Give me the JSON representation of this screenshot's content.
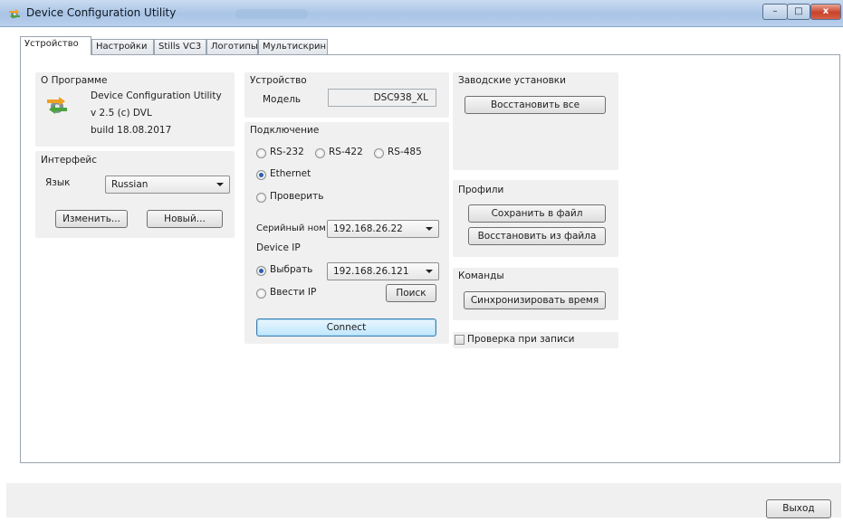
{
  "window": {
    "title": "Device Configuration Utility",
    "app_icon": "gear-arrows-icon",
    "controls": {
      "minimize": "–",
      "maximize": "□",
      "close": "x"
    }
  },
  "tabs": [
    {
      "label": "Устройство",
      "active": true
    },
    {
      "label": "Настройки",
      "active": false
    },
    {
      "label": "Stills VC3",
      "active": false
    },
    {
      "label": "Логотипы",
      "active": false
    },
    {
      "label": "Мультискрин",
      "active": false
    }
  ],
  "about": {
    "title": "О Программе",
    "product": "Device Configuration Utility",
    "version": "v 2.5  (c) DVL",
    "build": "build  18.08.2017",
    "icon": "gear-arrows-icon"
  },
  "interface": {
    "title": "Интерфейс",
    "language_label": "Язык",
    "language_value": "Russian",
    "change_button": "Изменить...",
    "new_button": "Новый..."
  },
  "device": {
    "title": "Устройство",
    "model_label": "Модель",
    "model_value": "DSC938_XL"
  },
  "connection": {
    "title": "Подключение",
    "rs232": "RS-232",
    "rs422": "RS-422",
    "rs485": "RS-485",
    "ethernet": "Ethernet",
    "check": "Проверить",
    "serial_label": "Серийный ном",
    "serial_value": "192.168.26.22",
    "device_ip_label": "Device IP",
    "select_label": "Выбрать",
    "select_value": "192.168.26.121",
    "enter_ip_label": "Ввести IP",
    "search_button": "Поиск",
    "connect_button": "Connect",
    "selected_interface": "Ethernet",
    "selected_ip_mode": "Выбрать"
  },
  "factory": {
    "title": "Заводские установки",
    "restore_all_button": "Восстановить все"
  },
  "profiles": {
    "title": "Профили",
    "save_button": "Сохранить в файл",
    "restore_button": "Восстановить из файла"
  },
  "commands": {
    "title": "Команды",
    "sync_time_button": "Синхронизировать время"
  },
  "verify": {
    "label": "Проверка при записи",
    "checked": false
  },
  "exit_button": "Выход",
  "colors": {
    "titlebar": "#a9c4e6",
    "group_bg": "#f0f0f0",
    "radio_dot": "#2a5fae",
    "close_button": "#c8432a"
  }
}
